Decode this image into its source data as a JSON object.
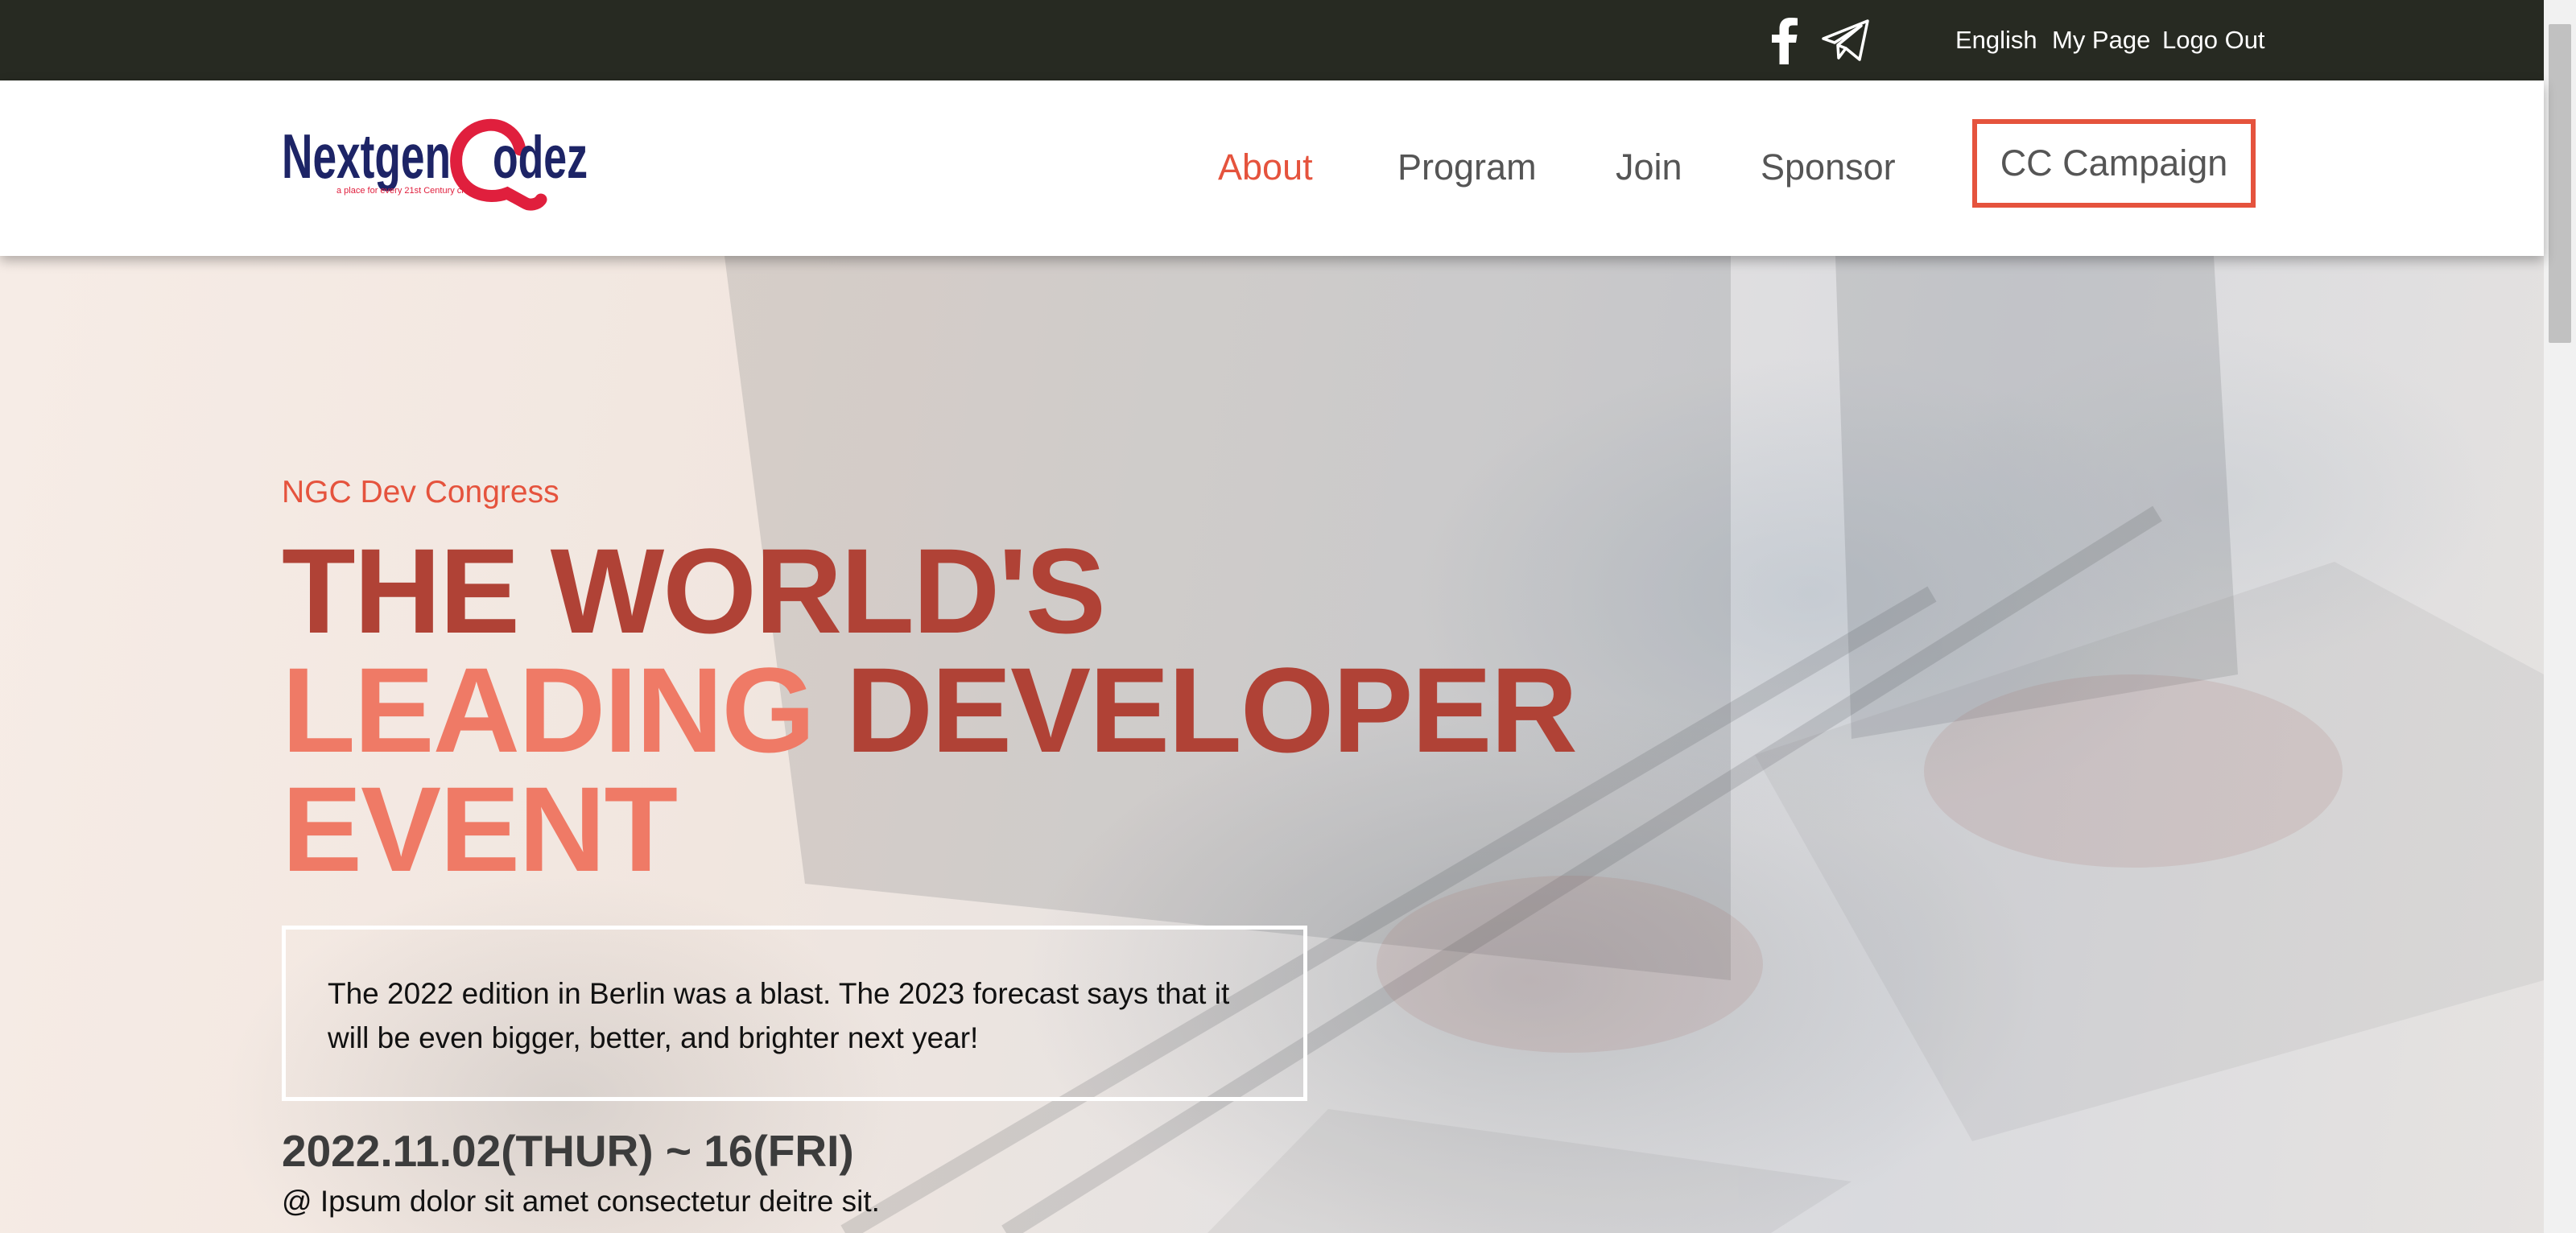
{
  "topbar": {
    "social": [
      {
        "icon": "facebook-icon"
      },
      {
        "icon": "telegram-icon"
      }
    ],
    "links": [
      "English",
      "My Page",
      "Logo Out"
    ]
  },
  "header": {
    "logo_text": "Nextgen Codez",
    "logo_tagline": "a place for every 21st Century child",
    "nav": [
      "About",
      "Program",
      "Join",
      "Sponsor"
    ],
    "active_nav": "About",
    "cta_label": "CC Campaign"
  },
  "hero": {
    "eyebrow": "NGC Dev Congress",
    "headline": {
      "line1": "THE WORLD'S",
      "line2_a": "LEADING",
      "line2_b": "DEVELOPER",
      "line3": "EVENT"
    },
    "description": "The 2022 edition in Berlin was a blast. The 2023 forecast says that it will be even bigger, better, and brighter next year!",
    "dates": "2022.11.02(THUR) ~ 16(FRI)",
    "venue": "@ Ipsum dolor sit amet consectetur deitre sit."
  },
  "colors": {
    "accent": "#e5533d",
    "topbar": "#272a22",
    "headline_dark": "#b04236",
    "headline_light": "#ef7a66"
  }
}
